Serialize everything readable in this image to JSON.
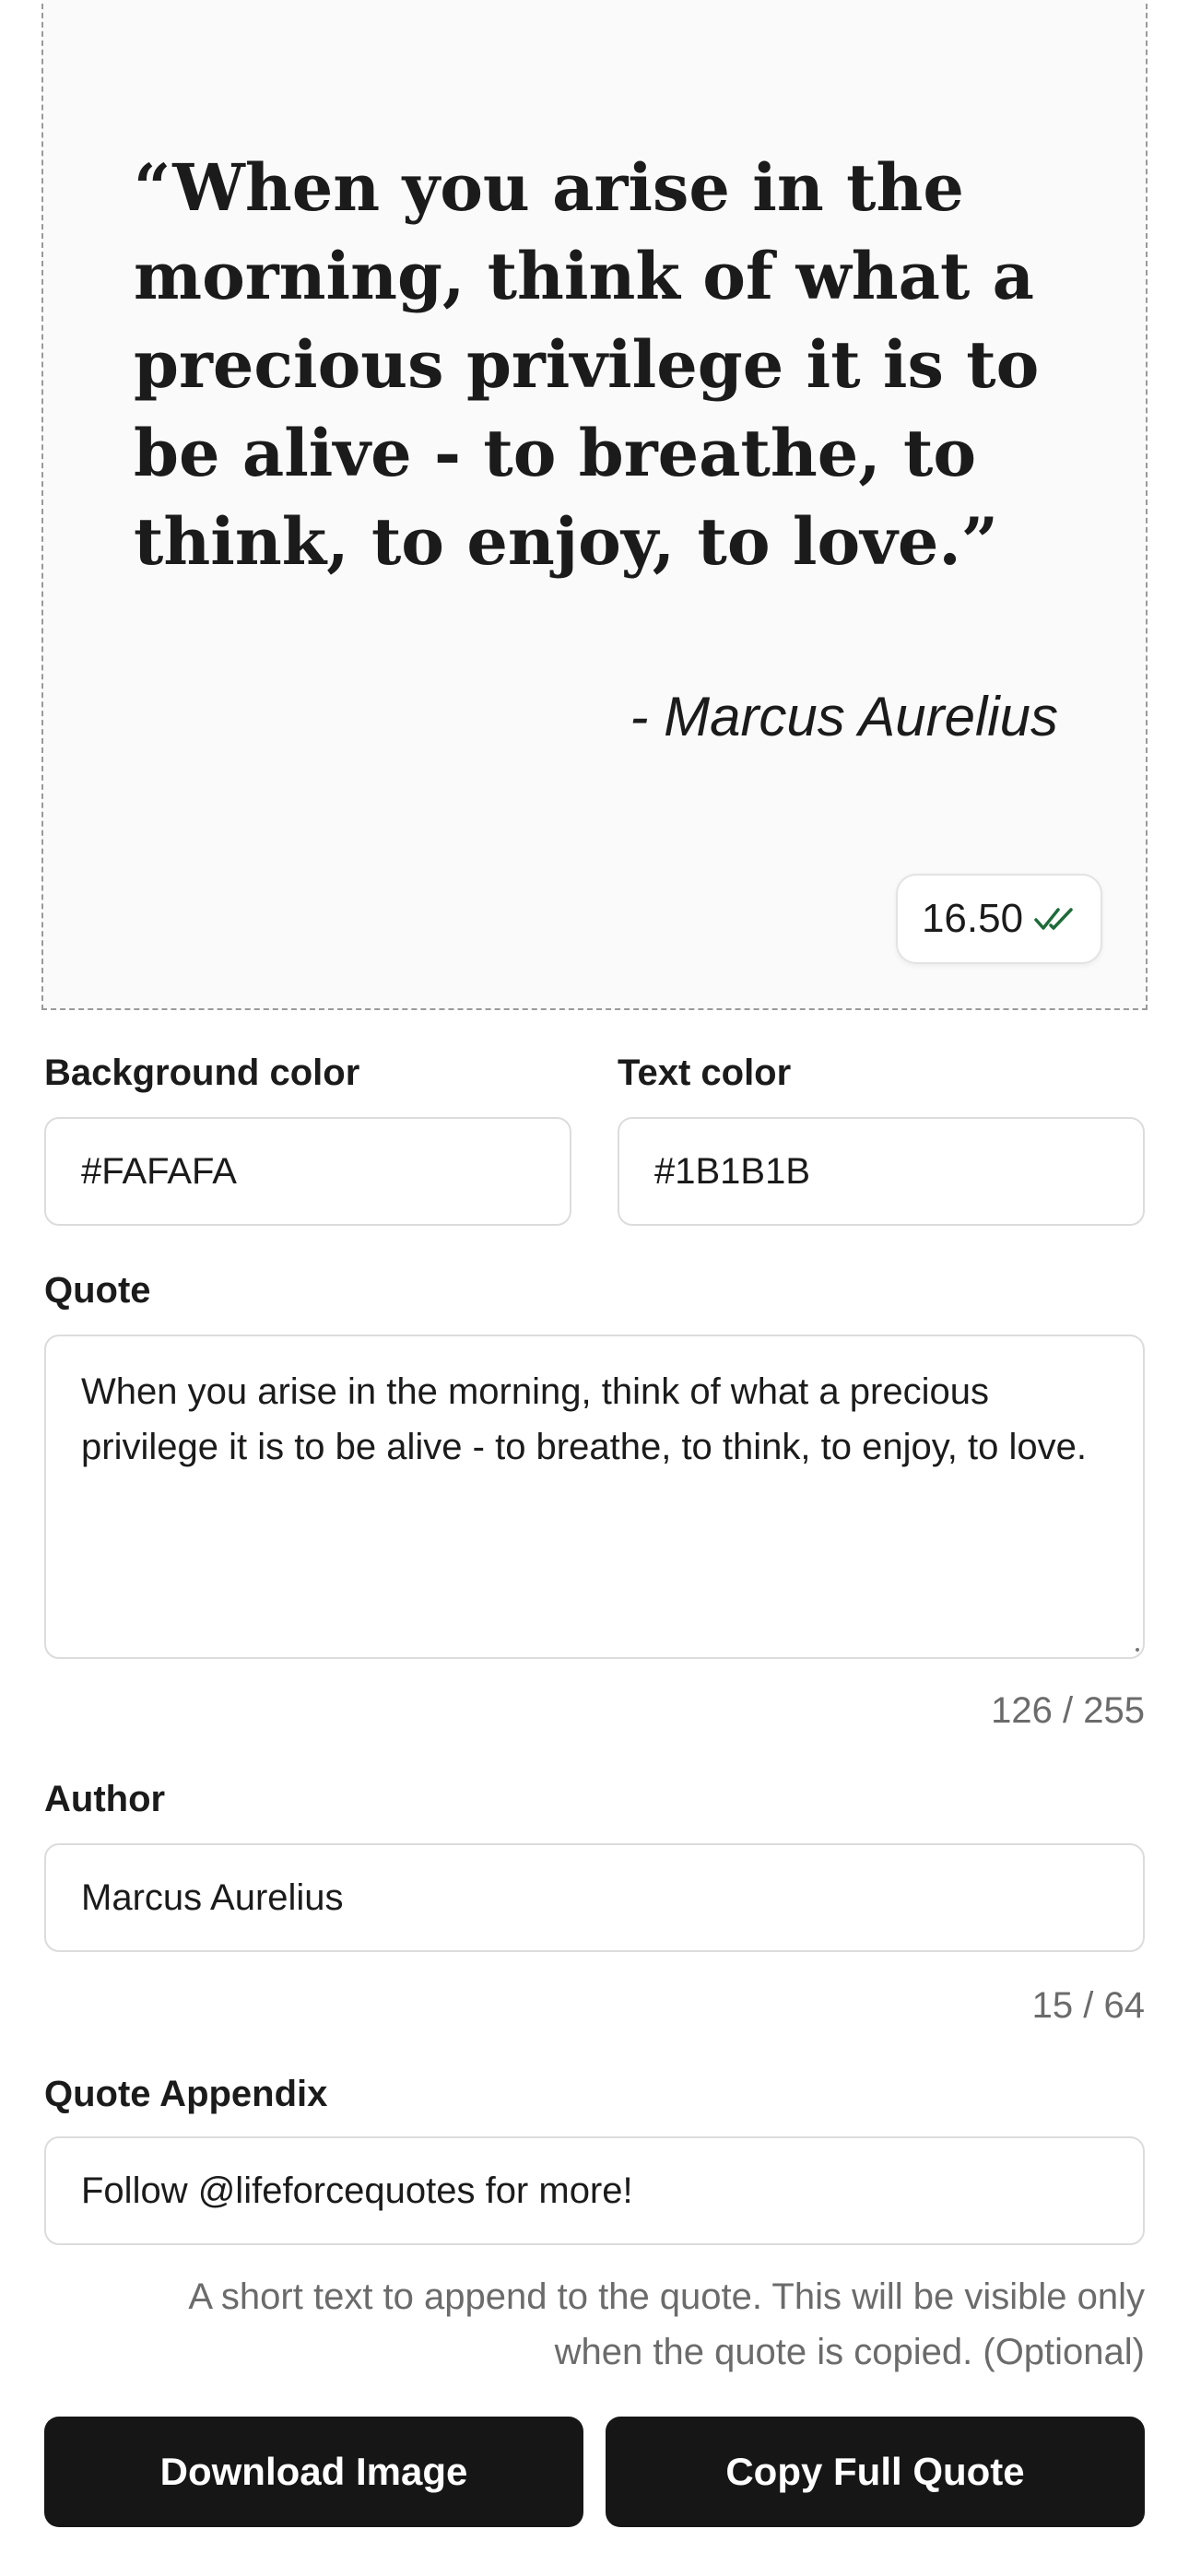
{
  "preview": {
    "quote_display": "“When you arise in the morning, think of what a precious privilege it is to be alive - to breathe, to think, to enjoy, to love.”",
    "author_display": "- Marcus Aurelius",
    "score": "16.50",
    "score_icon": "double-check-icon",
    "background_color": "#FAFAFA",
    "text_color": "#1B1B1B"
  },
  "form": {
    "background_color": {
      "label": "Background color",
      "value": "#FAFAFA"
    },
    "text_color": {
      "label": "Text color",
      "value": "#1B1B1B"
    },
    "quote": {
      "label": "Quote",
      "value": "When you arise in the morning, think of what a precious privilege it is to be alive - to breathe, to think, to enjoy, to love.",
      "counter": "126 / 255"
    },
    "author": {
      "label": "Author",
      "value": "Marcus Aurelius",
      "counter": "15 / 64"
    },
    "appendix": {
      "label": "Quote Appendix",
      "value": "Follow @lifeforcequotes for more!",
      "helper": "A short text to append to the quote. This will be visible only when the quote is copied. (Optional)"
    }
  },
  "actions": {
    "download_label": "Download Image",
    "copy_label": "Copy Full Quote"
  },
  "colors": {
    "button_bg": "#161616",
    "check_green": "#1e6b3a"
  }
}
